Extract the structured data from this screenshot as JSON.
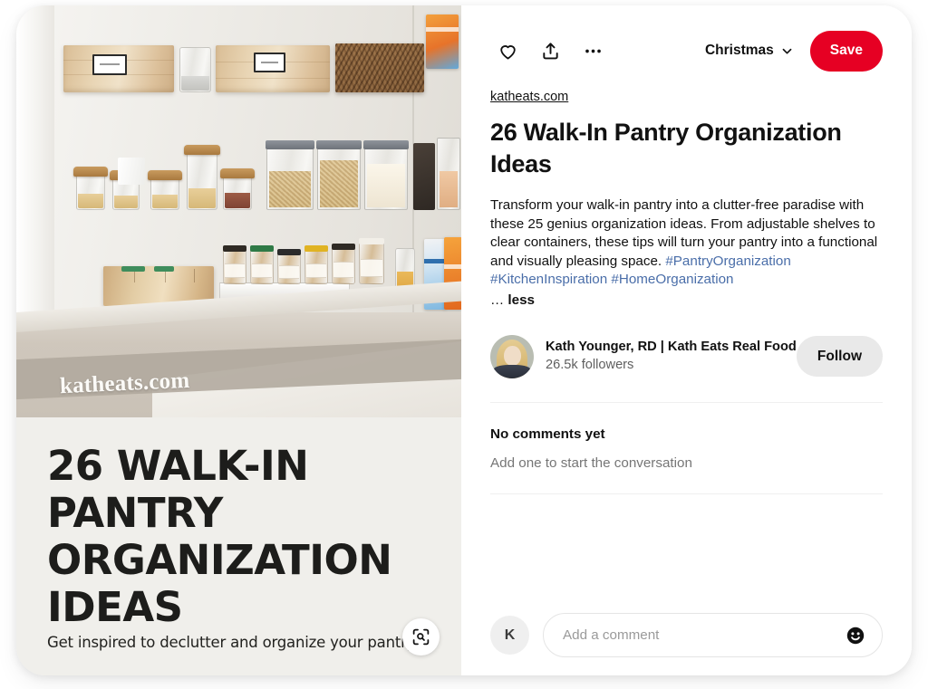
{
  "pin": {
    "source_domain": "katheats.com",
    "title": "26 Walk-In Pantry Organization Ideas",
    "description_text": "Transform your walk-in pantry into a clutter-free paradise with these 25 genius organization ideas. From adjustable shelves to clear containers, these tips will turn your pantry into a functional and visually pleasing space. ",
    "hashtags": [
      "#PantryOrganization",
      "#KitchenInspiration",
      "#HomeOrganization"
    ],
    "less_prefix": "… ",
    "less_label": "less"
  },
  "actions": {
    "react_icon": "heart-icon",
    "share_icon": "share-icon",
    "more_icon": "more-options-icon",
    "board_name": "Christmas",
    "board_chevron_icon": "chevron-down-icon",
    "save_label": "Save",
    "save_color": "#e60023"
  },
  "creator": {
    "avatar_name": "Kath Younger",
    "name": "Kath Younger, RD | Kath Eats Real Food",
    "followers": "26.5k followers",
    "follow_label": "Follow"
  },
  "comments": {
    "empty_title": "No comments yet",
    "empty_subtitle": "Add one to start the conversation",
    "user_initial": "K",
    "input_value": "",
    "input_placeholder": "Add a comment",
    "emoji_icon": "emoji-smiley-icon"
  },
  "image_overlay": {
    "watermark": "katheats.com",
    "headline": "26 Walk-In Pantry Organization Ideas",
    "subline": "Get inspired to declutter and organize your pantry!",
    "visual_search_icon": "visual-search-icon"
  }
}
